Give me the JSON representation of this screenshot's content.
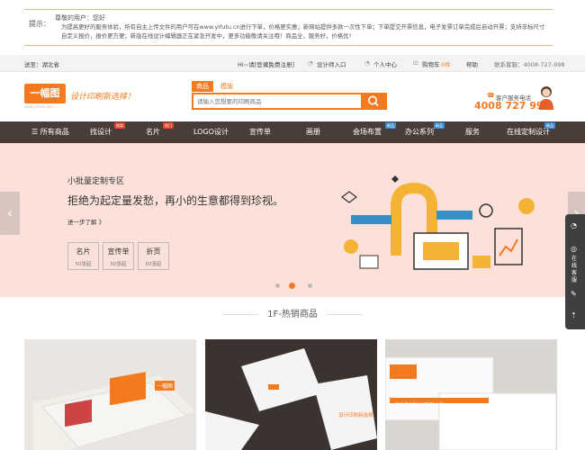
{
  "notice": {
    "label": "提示：",
    "line1": "尊敬的用户：您好",
    "line2": "为提高更好的服务体验，所有自主上传文件的用户可在www.yifutu.cn进行下单，价格更实惠；新网站提供多款一次性下单；下单提交开票信息，电子发票订单完成后自动开票；支持非标尺寸自定义报价，报价更方便；新版在线设计编辑器正在紧急开发中，更多功能敬请关注哦！商品全，服务好，价格优！"
  },
  "topbar": {
    "delivery": "送至：湖北省",
    "login": "Hi~请[登录]",
    "register": "[免费注册]",
    "designer": "设计师入口",
    "user_center": "个人中心",
    "cart": "购物车",
    "cart_count": "0件",
    "help": "帮助",
    "hotline": "联系客服：4008-727-998"
  },
  "logo": {
    "text": "一幅图",
    "sub": "www.yifutu.com",
    "slogan": "设计印刷新选择！"
  },
  "search": {
    "tabs": [
      "商品",
      "模版"
    ],
    "placeholder": "请输入您想要的印刷商品"
  },
  "service": {
    "label": "客户服务电话",
    "phone": "4008 727 998"
  },
  "nav": {
    "all": "所有商品",
    "items": [
      {
        "label": "找设计",
        "badge": "热卖"
      },
      {
        "label": "名片",
        "badge": "热门"
      },
      {
        "label": "LOGO设计",
        "badge": ""
      },
      {
        "label": "宣传单",
        "badge": ""
      },
      {
        "label": "画册",
        "badge": ""
      },
      {
        "label": "会场布置",
        "badge": "新品"
      },
      {
        "label": "办公系列",
        "badge": "新品"
      },
      {
        "label": "服务",
        "badge": ""
      },
      {
        "label": "在线定制设计",
        "badge": "新品"
      }
    ]
  },
  "banner": {
    "subtitle": "小批量定制专区",
    "title": "拒绝为起定量发愁，再小的生意都得到珍视。",
    "more": "进一步了解 》",
    "cards": [
      {
        "name": "名片",
        "qty": "50张起"
      },
      {
        "name": "宣传单",
        "qty": "50张起"
      },
      {
        "name": "折页",
        "qty": "50张起"
      }
    ]
  },
  "floor": {
    "title": "1F-热销商品"
  },
  "products": [
    {
      "text": "一幅图"
    },
    {
      "text": "设计印刷新选择"
    },
    {
      "text": "武汉幸福科技有限公司"
    }
  ],
  "float_bar": {
    "service": "在线客服"
  },
  "colors": {
    "accent": "#f47a20",
    "nav_bg": "#4a3c37",
    "banner_bg": "#fbe1da",
    "badge_red": "#e8412c",
    "badge_blue": "#3b8fd9"
  }
}
